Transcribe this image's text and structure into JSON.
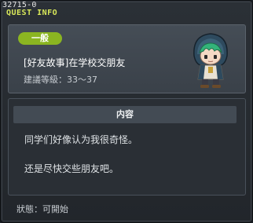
{
  "window": {
    "quest_id": "32715-0",
    "title": "QUEST INFO"
  },
  "header": {
    "badge": "一般",
    "quest_name": "[好友故事]在学校交朋友",
    "level_recommend": "建議等級：33～37"
  },
  "content": {
    "heading": "内容",
    "lines": [
      "同学们好像认为我很奇怪。",
      "还是尽快交些朋友吧。"
    ]
  },
  "status": {
    "text": "狀態：可開始"
  },
  "colors": {
    "title_yellow": "#d8e85a",
    "badge_green": "#8bb521"
  }
}
